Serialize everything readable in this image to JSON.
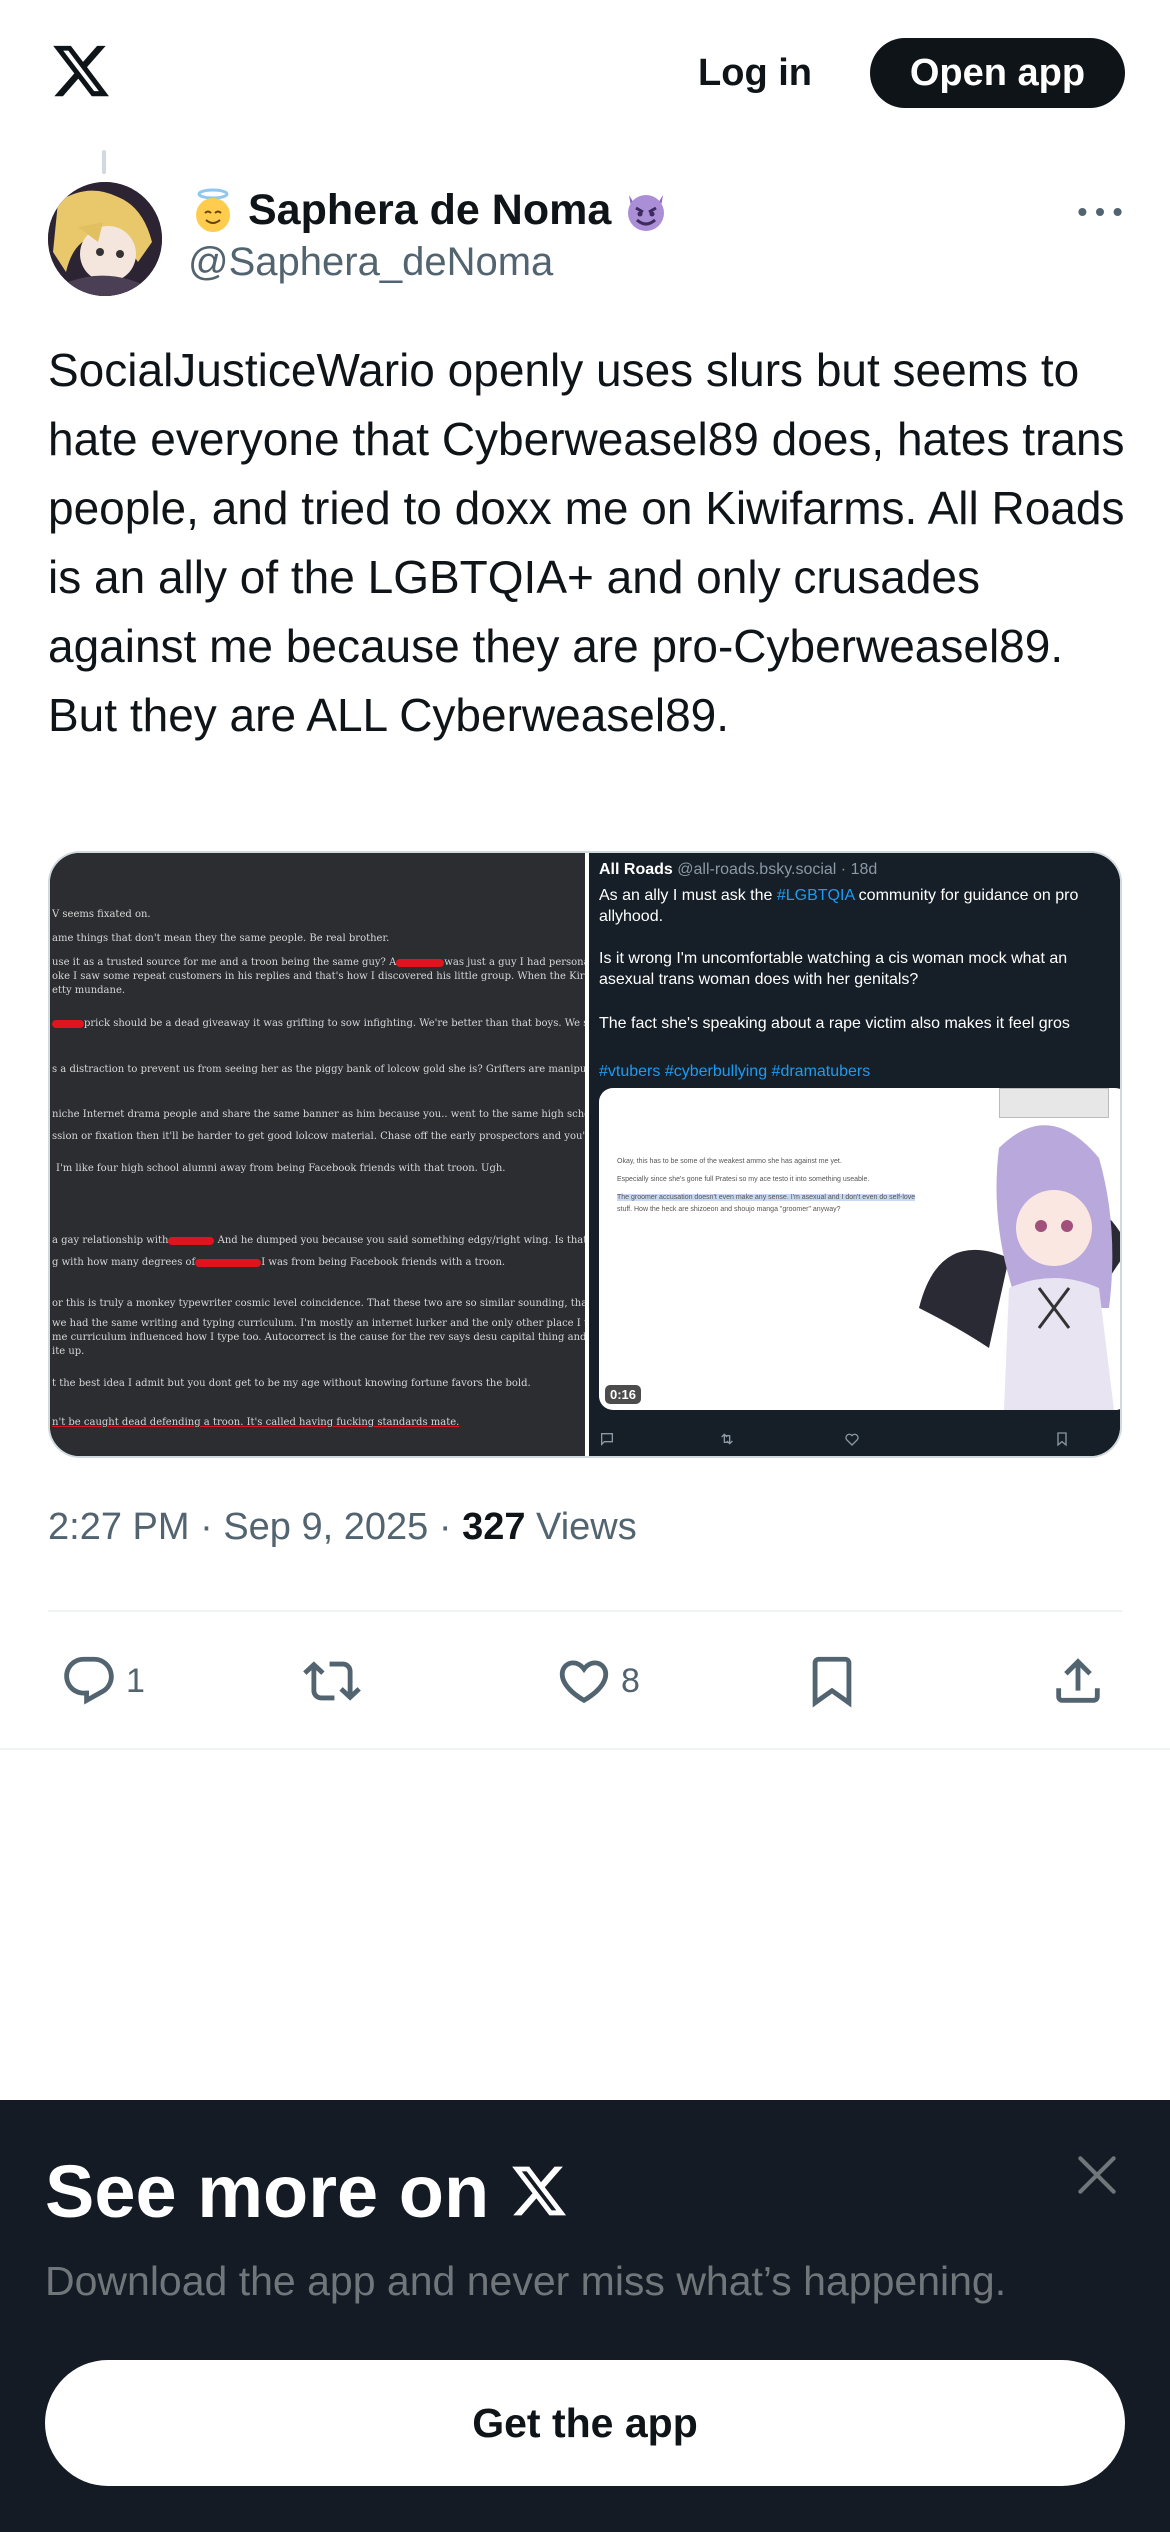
{
  "header": {
    "logo_icon": "x-logo-icon",
    "login_label": "Log in",
    "open_app_label": "Open app"
  },
  "tweet": {
    "author": {
      "display_name": "Saphera de Noma",
      "handle": "@Saphera_deNoma",
      "prefix_emoji": "angel-face-emoji",
      "suffix_emoji": "smiling-imp-emoji"
    },
    "text": "SocialJusticeWario openly uses slurs but seems to hate everyone that Cyberweasel89 does, hates trans people, and tried to doxx me on Kiwifarms. All Roads is an ally of the LGBTQIA+ and only crusades against me because they are pro-Cyberweasel89. But they are ALL Cyberweasel89.",
    "media": {
      "left_image_lines": [
        "V seems fixated on.",
        "ame things that don't mean they the same people. Be real brother.",
        "use it as a trusted source for me and a troon being the same guy? A",
        "was just a guy I had personal h",
        "oke I saw some repeat customers in his replies and that's how I discovered his little group. When the Kirsch s",
        "etty mundane.",
        "prick should be a dead giveaway it was grifting to sow infighting. We're better than that boys. We shouldn",
        "s a distraction to prevent us from seeing her as the piggy bank of lolcow gold she is? Grifters are manipulators",
        "niche Internet drama people and share the same banner as him because you.. went to the same high school? How does that m",
        "ssion or fixation then it'll be harder to get good lolcow material. Chase off the early prospectors and you'll be",
        "I'm like four high school alumni away from being Facebook friends with that troon. Ugh.",
        "a gay relationship with",
        "And he dumped you because you said something edgy/right wing. Is that what happened?",
        "g with how many degrees of",
        "I was from being Facebook friends with a troon.",
        "or this is truly a monkey typewriter cosmic level coincidence. That these two are so similar sounding, that is.",
        "we had the same writing and typing curriculum. I'm mostly an internet lurker and the only other place I talk as",
        "me curriculum influenced how I type too. Autocorrect is the cause for the rev says desu capital thing and may",
        "ite up.",
        "t the best idea I admit but you dont get to be my age without knowing fortune favors the bold.",
        "n't be caught dead defending a troon. It's called having fucking standards mate."
      ],
      "right_image": {
        "author_name": "All Roads",
        "author_handle": "@all-roads.bsky.social · 18d",
        "line1_pre": "As an ally I must ask the ",
        "line1_tag": "#LGBTQIA",
        "line1_post": " community for guidance on pro",
        "line2": "allyhood.",
        "line3": "Is it wrong I'm uncomfortable watching a cis woman mock what an",
        "line4": "asexual trans woman does with her genitals?",
        "line5": "The fact she's speaking about a rape victim also makes it feel gros",
        "hashtags": "#vtubers #cyberbullying #dramatubers",
        "video_lines": [
          "Okay, this has to be some of the weakest ammo she has against me yet.",
          "Especially since she's gone full Pratesi so my ace testo it into something useable.",
          "The groomer accusation doesn't even make any sense. I'm asexual and I don't even do self-love",
          "stuff. How the heck are shizoeon and shoujo manga \"groomer\" anyway?"
        ],
        "video_duration": "0:16"
      }
    },
    "time": "2:27 PM",
    "date": "Sep 9, 2025",
    "views_count": "327",
    "views_label": "Views",
    "actions": {
      "reply_count": "1",
      "like_count": "8"
    }
  },
  "bottom_sheet": {
    "title": "See more on",
    "subtitle": "Download the app and never miss what’s happening.",
    "button_label": "Get the app"
  },
  "colors": {
    "text_primary": "#0f1419",
    "text_secondary": "#536471",
    "link_blue": "#1d9bf0",
    "sheet_bg": "#141b24",
    "redaction_red": "#e0141e"
  }
}
